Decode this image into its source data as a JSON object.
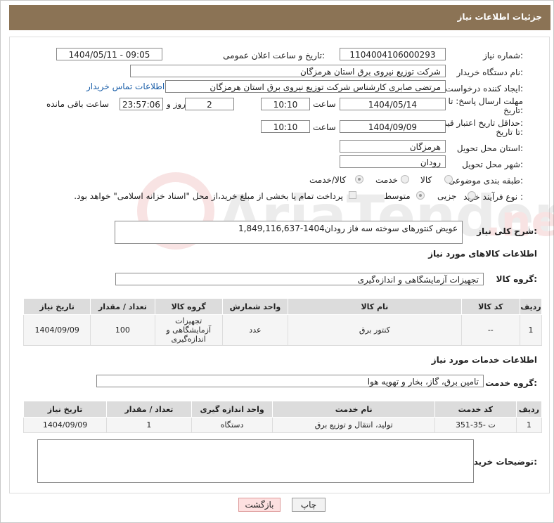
{
  "header": {
    "title": "جزئیات اطلاعات نیاز"
  },
  "form": {
    "need_number_label": "شماره نیاز:",
    "need_number": "1104004106000293",
    "announce_label": "تاریخ و ساعت اعلان عمومی:",
    "announce_value": "1404/05/11 - 09:05",
    "buyer_org_label": "نام دستگاه خریدار:",
    "buyer_org": "شرکت توزیع نیروی برق استان هرمزگان",
    "creator_label": "ایجاد کننده درخواست:",
    "creator": "مرتضی صابری کارشناس شرکت توزیع نیروی برق استان هرمزگان",
    "contact_link": "اطلاعات تماس خریدار",
    "deadline_label_1": "مهلت ارسال پاسخ: تا",
    "deadline_label_2": "تاریخ:",
    "deadline_date": "1404/05/14",
    "time_label": "ساعت",
    "deadline_time": "10:10",
    "days_value": "2",
    "days_label": "روز و",
    "remaining_time": "23:57:06",
    "remaining_label": "ساعت باقی مانده",
    "min_price_label_1": "حداقل تاریخ اعتبار قیمت:",
    "min_price_label_2": "تا تاریخ:",
    "min_price_date": "1404/09/09",
    "min_price_time": "10:10",
    "province_label": "استان محل تحویل:",
    "province": "هرمزگان",
    "city_label": "شهر محل تحویل:",
    "city": "رودان",
    "category_label": "طبقه بندی موضوعی:",
    "category_options": [
      "کالا",
      "خدمت",
      "کالا/خدمت"
    ],
    "process_label": "نوع فرآیند خرید :",
    "process_options": [
      "جزیی",
      "متوسط"
    ],
    "payment_note": "پرداخت تمام یا بخشی از مبلغ خرید،از محل \"اسناد خزانه اسلامی\" خواهد بود."
  },
  "description": {
    "label": "شرح کلی نیاز:",
    "value": "عویض کنتورهای سوخته سه فاز رودان1404-1,849,116,637"
  },
  "goods": {
    "section_title": "اطلاعات کالاهای مورد نیاز",
    "group_label": "گروه کالا:",
    "group_value": "تجهیزات آزمایشگاهی و اندازه‌گیری",
    "columns": [
      "ردیف",
      "کد کالا",
      "نام کالا",
      "واحد شمارش",
      "گروه کالا",
      "تعداد / مقدار",
      "تاریخ نیاز"
    ],
    "rows": [
      {
        "row": "1",
        "code": "--",
        "name": "کنتور برق",
        "unit": "عدد",
        "group": "تجهیزات آزمایشگاهی و اندازه‌گیری",
        "qty": "100",
        "date": "1404/09/09"
      }
    ]
  },
  "services": {
    "section_title": "اطلاعات خدمات مورد نیاز",
    "group_label": "گروه خدمت:",
    "group_value": "تامین برق، گاز، بخار و تهویه هوا",
    "columns": [
      "ردیف",
      "کد خدمت",
      "نام خدمت",
      "واحد اندازه گیری",
      "تعداد / مقدار",
      "تاریخ نیاز"
    ],
    "rows": [
      {
        "row": "1",
        "code": "ت -35-351",
        "name": "تولید، انتقال و توزیع برق",
        "unit": "دستگاه",
        "qty": "1",
        "date": "1404/09/09"
      }
    ]
  },
  "buyer_notes": {
    "label": "توضیحات خریدار:",
    "value": ""
  },
  "buttons": {
    "print": "چاپ",
    "back": "بازگشت"
  },
  "colors": {
    "header": "#8b7355",
    "link": "#1a5ea8"
  }
}
